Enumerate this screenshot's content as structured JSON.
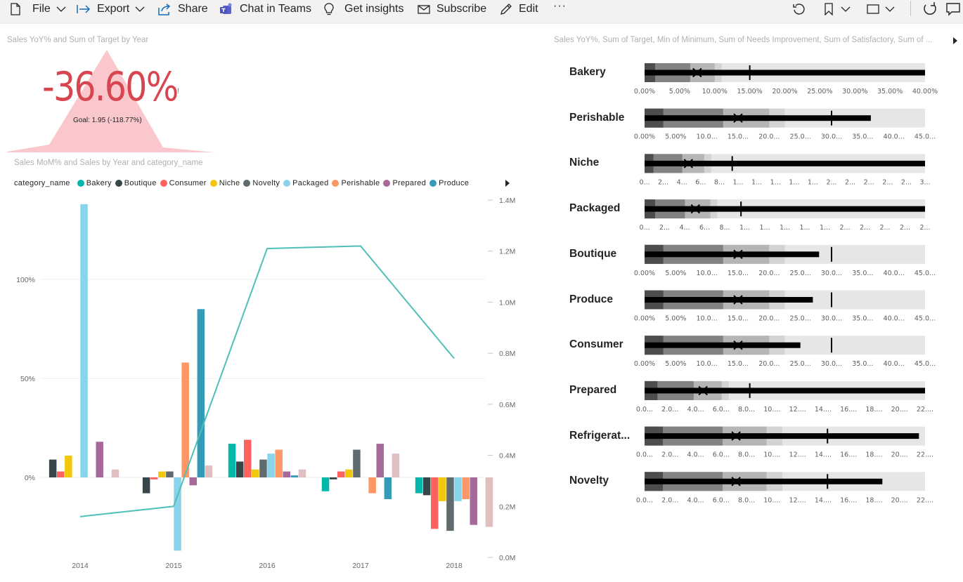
{
  "toolbar": {
    "file": "File",
    "export": "Export",
    "share": "Share",
    "chat_in_teams": "Chat in Teams",
    "get_insights": "Get insights",
    "subscribe": "Subscribe",
    "edit": "Edit",
    "more": "···"
  },
  "kpi": {
    "title": "Sales YoY% and Sum of Target by Year",
    "value": "-36.60%",
    "goal": "Goal: 1.95 (-118.77%)",
    "status_color": "#d64550"
  },
  "combo": {
    "title": "Sales MoM% and Sales by Year and category_name",
    "legend_title": "category_name"
  },
  "bullet": {
    "title": "Sales YoY%, Sum of Target, Min of Minimum, Sum of Needs Improvement, Sum of Satisfactory, Sum of ..."
  },
  "chart_data": [
    {
      "type": "bar",
      "title": "Sales MoM% and Sales by Year and category_name",
      "categories": [
        "2014",
        "2015",
        "2016",
        "2017",
        "2018"
      ],
      "series": [
        {
          "name": "Bakery",
          "color": "#01b8aa",
          "values": [
            null,
            null,
            17,
            -7,
            -8
          ]
        },
        {
          "name": "Boutique",
          "color": "#374649",
          "values": [
            9,
            -8,
            8,
            -1,
            -9
          ]
        },
        {
          "name": "Consumer",
          "color": "#fd625e",
          "values": [
            3,
            -1,
            19,
            3,
            -26
          ]
        },
        {
          "name": "Niche",
          "color": "#f2c80f",
          "values": [
            11,
            3,
            4,
            4,
            -12
          ]
        },
        {
          "name": "Novelty",
          "color": "#5f6b6d",
          "values": [
            null,
            3,
            9,
            14,
            -27
          ]
        },
        {
          "name": "Packaged",
          "color": "#8ad4eb",
          "values": [
            138,
            -37,
            12,
            null,
            -12
          ]
        },
        {
          "name": "Perishable",
          "color": "#fe9666",
          "values": [
            null,
            58,
            14,
            -8,
            -11
          ]
        },
        {
          "name": "Prepared",
          "color": "#a66999",
          "values": [
            18,
            -4,
            3,
            17,
            -24
          ]
        },
        {
          "name": "Produce",
          "color": "#3599b8",
          "values": [
            null,
            85,
            1,
            -11,
            null
          ]
        },
        {
          "name": "Refrigerated",
          "color": "#dfbfbf",
          "values": [
            4,
            6,
            4,
            12,
            -25
          ]
        }
      ],
      "line": {
        "name": "Sales",
        "axis": "right",
        "color": "#4ec0b8",
        "values": [
          0.16,
          0.2,
          1.21,
          1.22,
          0.78
        ]
      },
      "y_left": {
        "ticks": [
          "100%",
          "50%",
          "0%"
        ],
        "range": [
          -40,
          140
        ]
      },
      "y_right": {
        "ticks": [
          "1.4M",
          "1.2M",
          "1.0M",
          "0.8M",
          "0.6M",
          "0.4M",
          "0.2M",
          "0.0M"
        ],
        "range": [
          0,
          1.4
        ]
      },
      "legend": "top"
    },
    {
      "type": "bullet",
      "rows": [
        {
          "name": "Bakery",
          "max": 40,
          "actual": 40,
          "target": 15,
          "x_marker": 7.5,
          "bands": [
            1.5,
            6.5,
            10,
            11
          ],
          "ticks": [
            "0.00%",
            "5.00%",
            "10.00%",
            "15.00%",
            "20.00%",
            "25.00%",
            "30.00%",
            "35.00%",
            "40.00%"
          ]
        },
        {
          "name": "Perishable",
          "max": 45,
          "actual": 36.3,
          "target": 30,
          "x_marker": 15,
          "bands": [
            3,
            12.6,
            20,
            22.5
          ],
          "ticks": [
            "0.00%",
            "5.00%",
            "10.0...",
            "15.0...",
            "20.0...",
            "25.0...",
            "30.0...",
            "35.0...",
            "40.0...",
            "45.0..."
          ]
        },
        {
          "name": "Niche",
          "max": 32,
          "actual": 32,
          "target": 10,
          "x_marker": 5,
          "bands": [
            1,
            4.3,
            6.8,
            7.6
          ],
          "ticks": [
            "0...",
            "2...",
            "4...",
            "6...",
            "8...",
            "1...",
            "1...",
            "1...",
            "1...",
            "1...",
            "2...",
            "2...",
            "2...",
            "2...",
            "2...",
            "3..."
          ]
        },
        {
          "name": "Packaged",
          "max": 32,
          "actual": 32,
          "target": 11,
          "x_marker": 5.8,
          "bands": [
            1.2,
            4.6,
            7.5,
            8.3
          ],
          "ticks": [
            "0...",
            "2...",
            "4...",
            "6...",
            "8...",
            "1...",
            "1...",
            "1...",
            "1...",
            "1...",
            "2...",
            "2...",
            "2...",
            "2...",
            "2..."
          ]
        },
        {
          "name": "Boutique",
          "max": 45,
          "actual": 28,
          "target": 30,
          "x_marker": 15,
          "bands": [
            3,
            12.6,
            20,
            22.5
          ],
          "ticks": [
            "0.00%",
            "5.00%",
            "10.0...",
            "15.0...",
            "20.0...",
            "25.0...",
            "30.0...",
            "35.0...",
            "40.0...",
            "45.0..."
          ]
        },
        {
          "name": "Produce",
          "max": 45,
          "actual": 27,
          "target": 30,
          "x_marker": 15,
          "bands": [
            3,
            12.6,
            20,
            22.5
          ],
          "ticks": [
            "0.00%",
            "5.00%",
            "10.0...",
            "15.0...",
            "20.0...",
            "25.0...",
            "30.0...",
            "35.0...",
            "40.0...",
            "45.0..."
          ]
        },
        {
          "name": "Consumer",
          "max": 45,
          "actual": 25,
          "target": 30,
          "x_marker": 15,
          "bands": [
            3,
            12.6,
            20,
            22.5
          ],
          "ticks": [
            "0.00%",
            "5.00%",
            "10.0...",
            "15.0...",
            "20.0...",
            "25.0...",
            "30.0...",
            "35.0...",
            "40.0...",
            "45.0..."
          ]
        },
        {
          "name": "Prepared",
          "max": 24,
          "actual": 24,
          "target": 9,
          "x_marker": 5,
          "bands": [
            1.1,
            4.2,
            6.6,
            7.2
          ],
          "ticks": [
            "0.0...",
            "2.0...",
            "4.0...",
            "6.0...",
            "8.0...",
            "10....",
            "12....",
            "14....",
            "16....",
            "18....",
            "20....",
            "22...."
          ]
        },
        {
          "name": "Refrigerated",
          "display_name": "Refrigerat...",
          "max": 23,
          "actual": 22.5,
          "target": 15,
          "x_marker": 7.5,
          "bands": [
            1.5,
            6.4,
            10,
            11.3
          ],
          "ticks": [
            "0.0...",
            "2.0...",
            "4.0...",
            "6.0...",
            "8.0...",
            "10....",
            "12....",
            "14....",
            "16....",
            "18....",
            "20....",
            "22...."
          ]
        },
        {
          "name": "Novelty",
          "max": 23,
          "actual": 19.5,
          "target": 15,
          "x_marker": 7.5,
          "bands": [
            1.5,
            6.4,
            10,
            11.3
          ],
          "ticks": [
            "0.0...",
            "2.0...",
            "4.0...",
            "6.0...",
            "8.0...",
            "10....",
            "12....",
            "14....",
            "16....",
            "18....",
            "20....",
            "22...."
          ]
        }
      ]
    }
  ]
}
